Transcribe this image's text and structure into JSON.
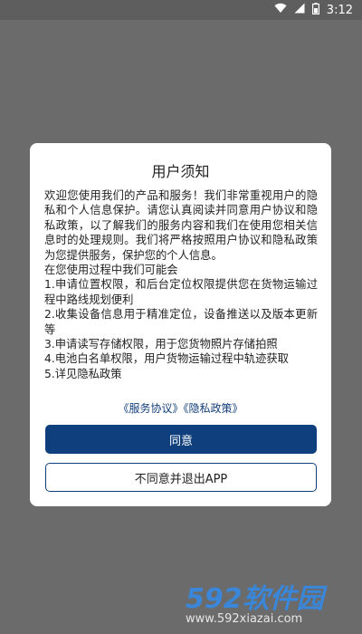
{
  "status_bar": {
    "time": "3:12",
    "icons": [
      "wifi-icon",
      "signal-icon",
      "battery-icon"
    ]
  },
  "dialog": {
    "title": "用户须知",
    "intro": "欢迎您使用我们的产品和服务！我们非常重视用户的隐私和个人信息保护。请您认真阅读并同意用户协议和隐私政策，以了解我们的服务内容和我们在使用您相关信息时的处理规则。我们将严格按照用户协议和隐私政策为您提供服务，保护您的个人信息。",
    "usage_intro": "在您使用过程中我们可能会",
    "items": [
      " 1.申请位置权限，和后台定位权限提供您在货物运输过程中路线规划便利",
      " 2.收集设备信息用于精准定位，设备推送以及版本更新等",
      " 3.申请读写存储权限，用于您货物照片存储拍照",
      " 4.电池白名单权限，用户货物运输过程中轨迹获取",
      " 5.详见隐私政策"
    ],
    "links": {
      "service_agreement": "《服务协议》",
      "privacy_policy": "《隐私政策》"
    },
    "agree_label": "同意",
    "disagree_label": "不同意并退出APP"
  },
  "watermark": {
    "logo_text": "592软件园",
    "url": "www.592xiazai.com"
  }
}
